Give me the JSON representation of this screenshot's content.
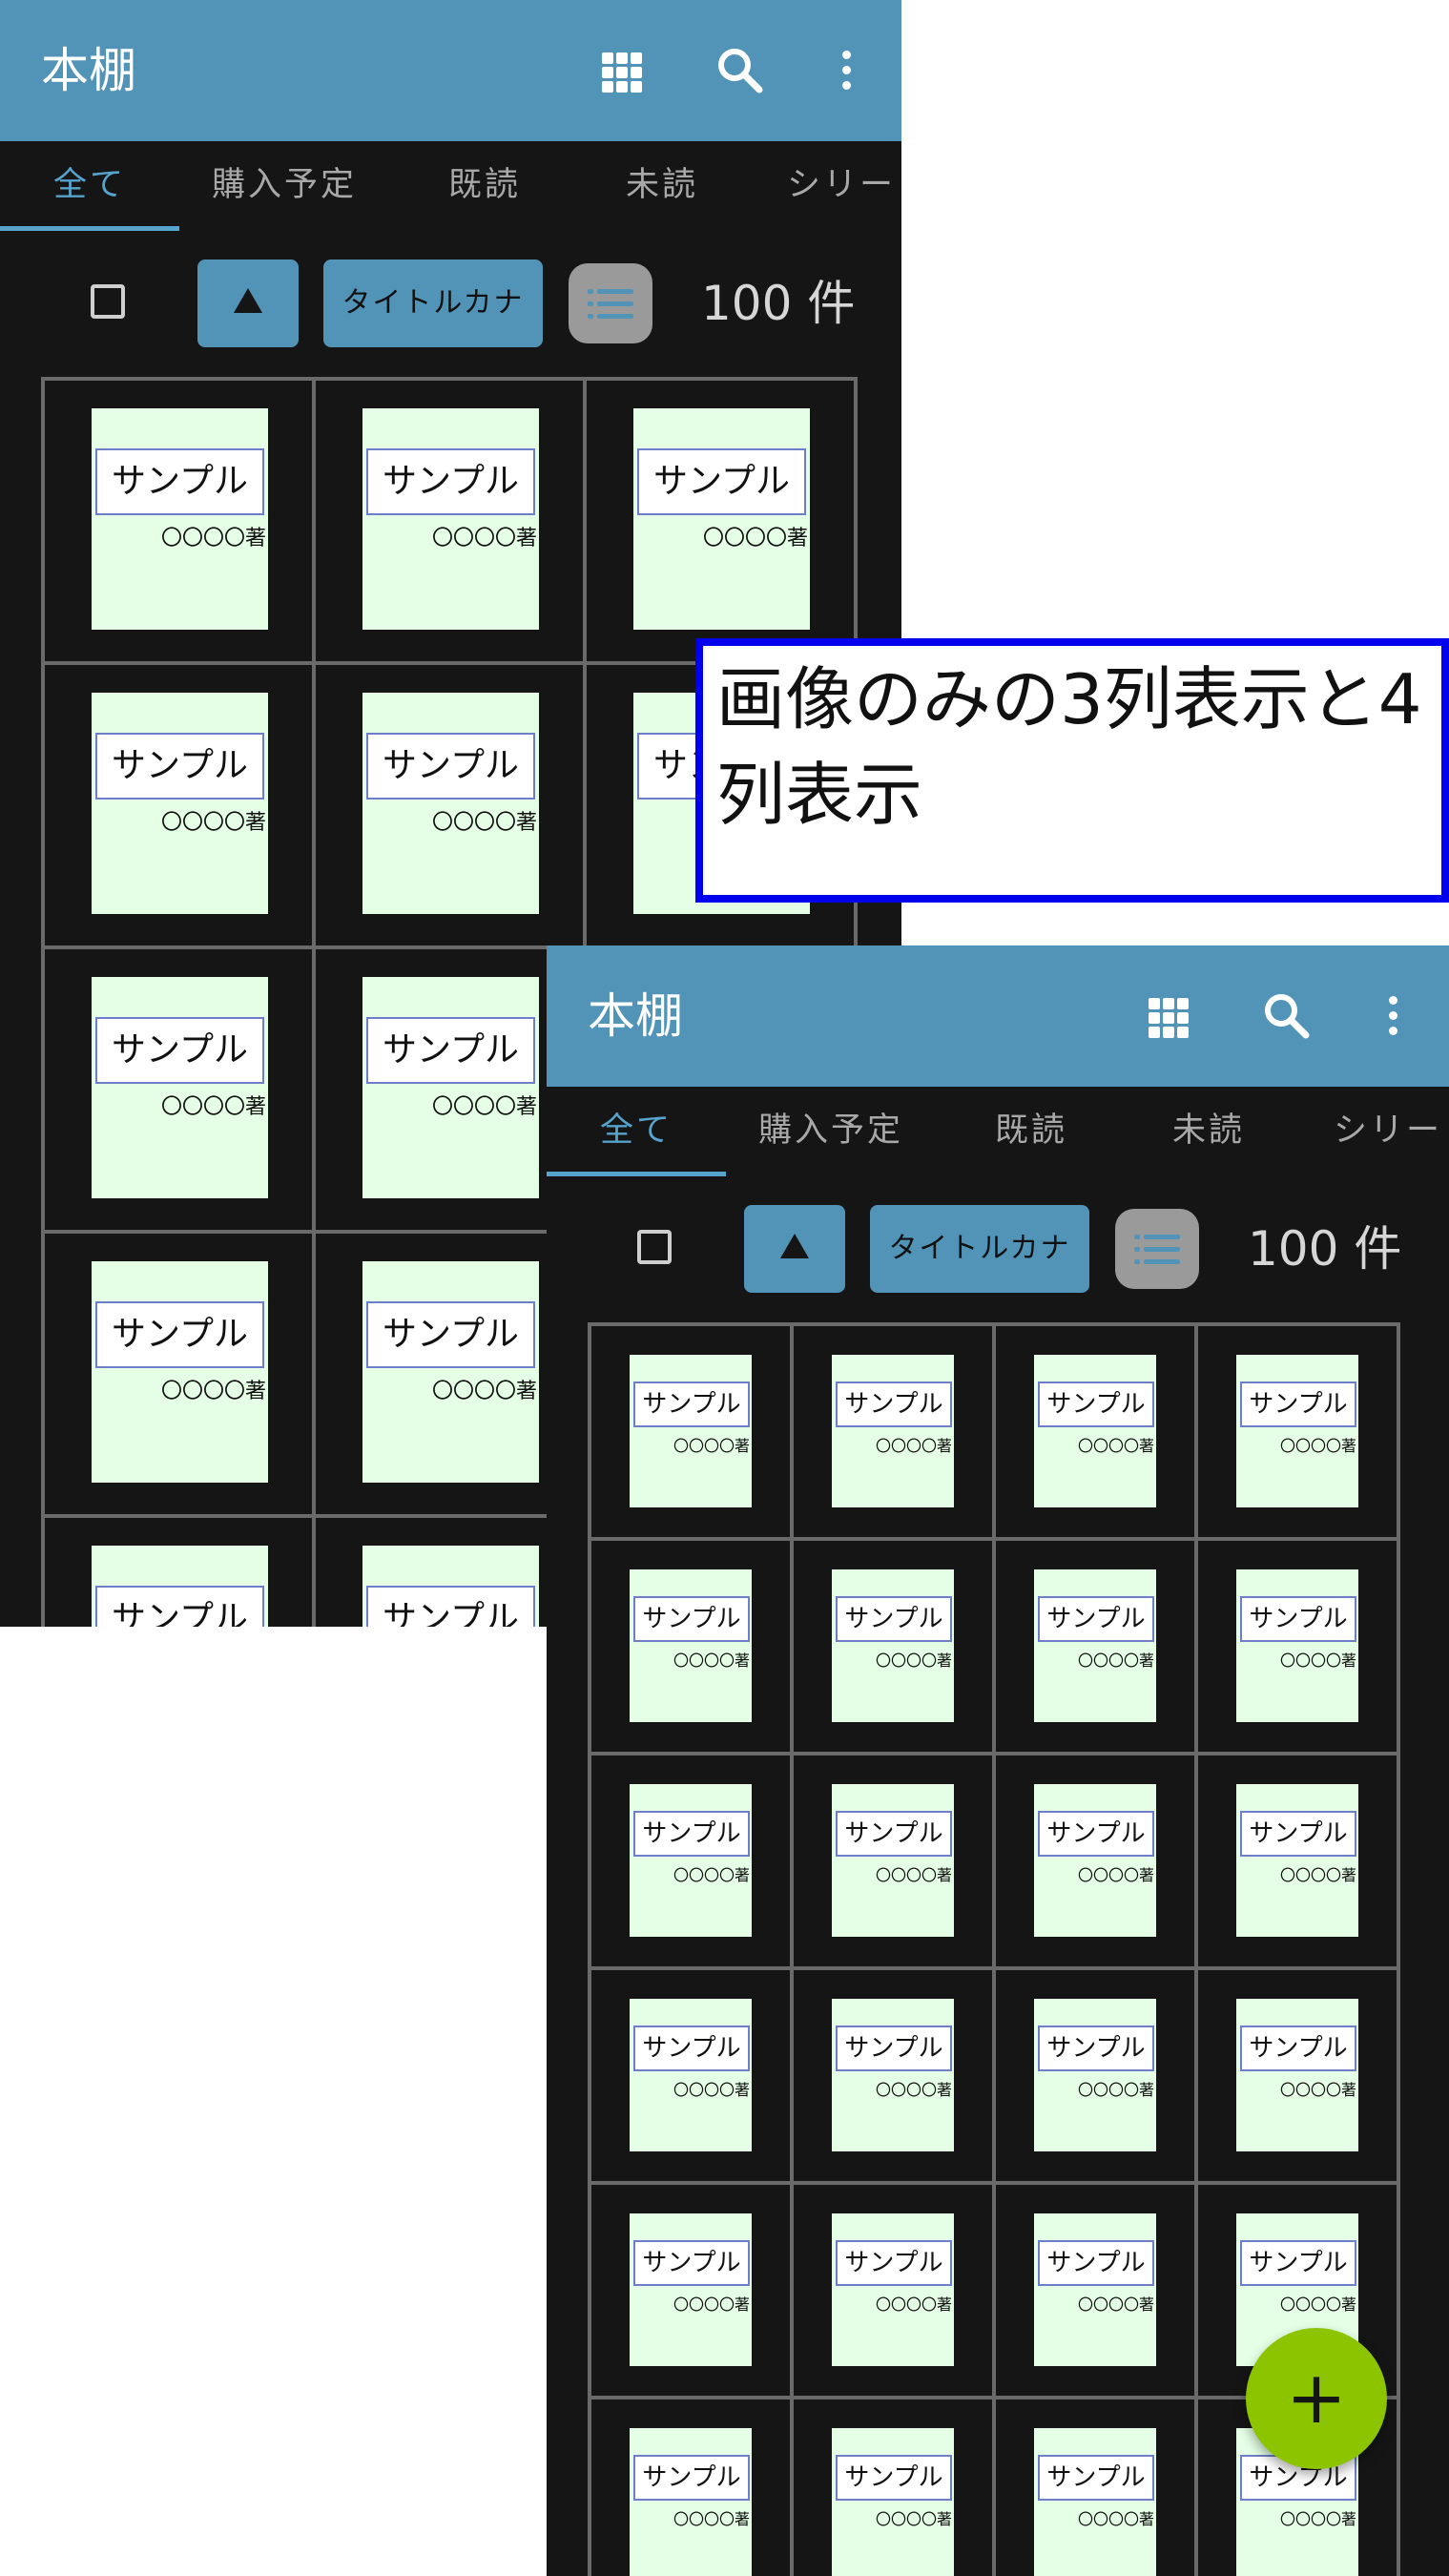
{
  "appbar": {
    "title": "本棚",
    "icons": [
      "grid-view-icon",
      "search-icon",
      "more-vert-icon"
    ]
  },
  "tabs": [
    {
      "label": "全て",
      "active": true
    },
    {
      "label": "購入予定"
    },
    {
      "label": "既読"
    },
    {
      "label": "未読"
    },
    {
      "label": "シリー"
    }
  ],
  "toolbar": {
    "sort_order_symbol": "▲",
    "sort_field": "タイトルカナ",
    "count": "100 件"
  },
  "book": {
    "title": "サンプル",
    "author": "〇〇〇〇著"
  },
  "caption": "画像のみの3列表示と4列表示",
  "fab": {
    "symbol": "+"
  },
  "colors": {
    "appbar": "#5294b8",
    "accent": "#56a3cd",
    "background": "#151515",
    "book_cover": "#e4ffe5",
    "caption_border": "#0000ee",
    "fab": "#8cc400"
  }
}
